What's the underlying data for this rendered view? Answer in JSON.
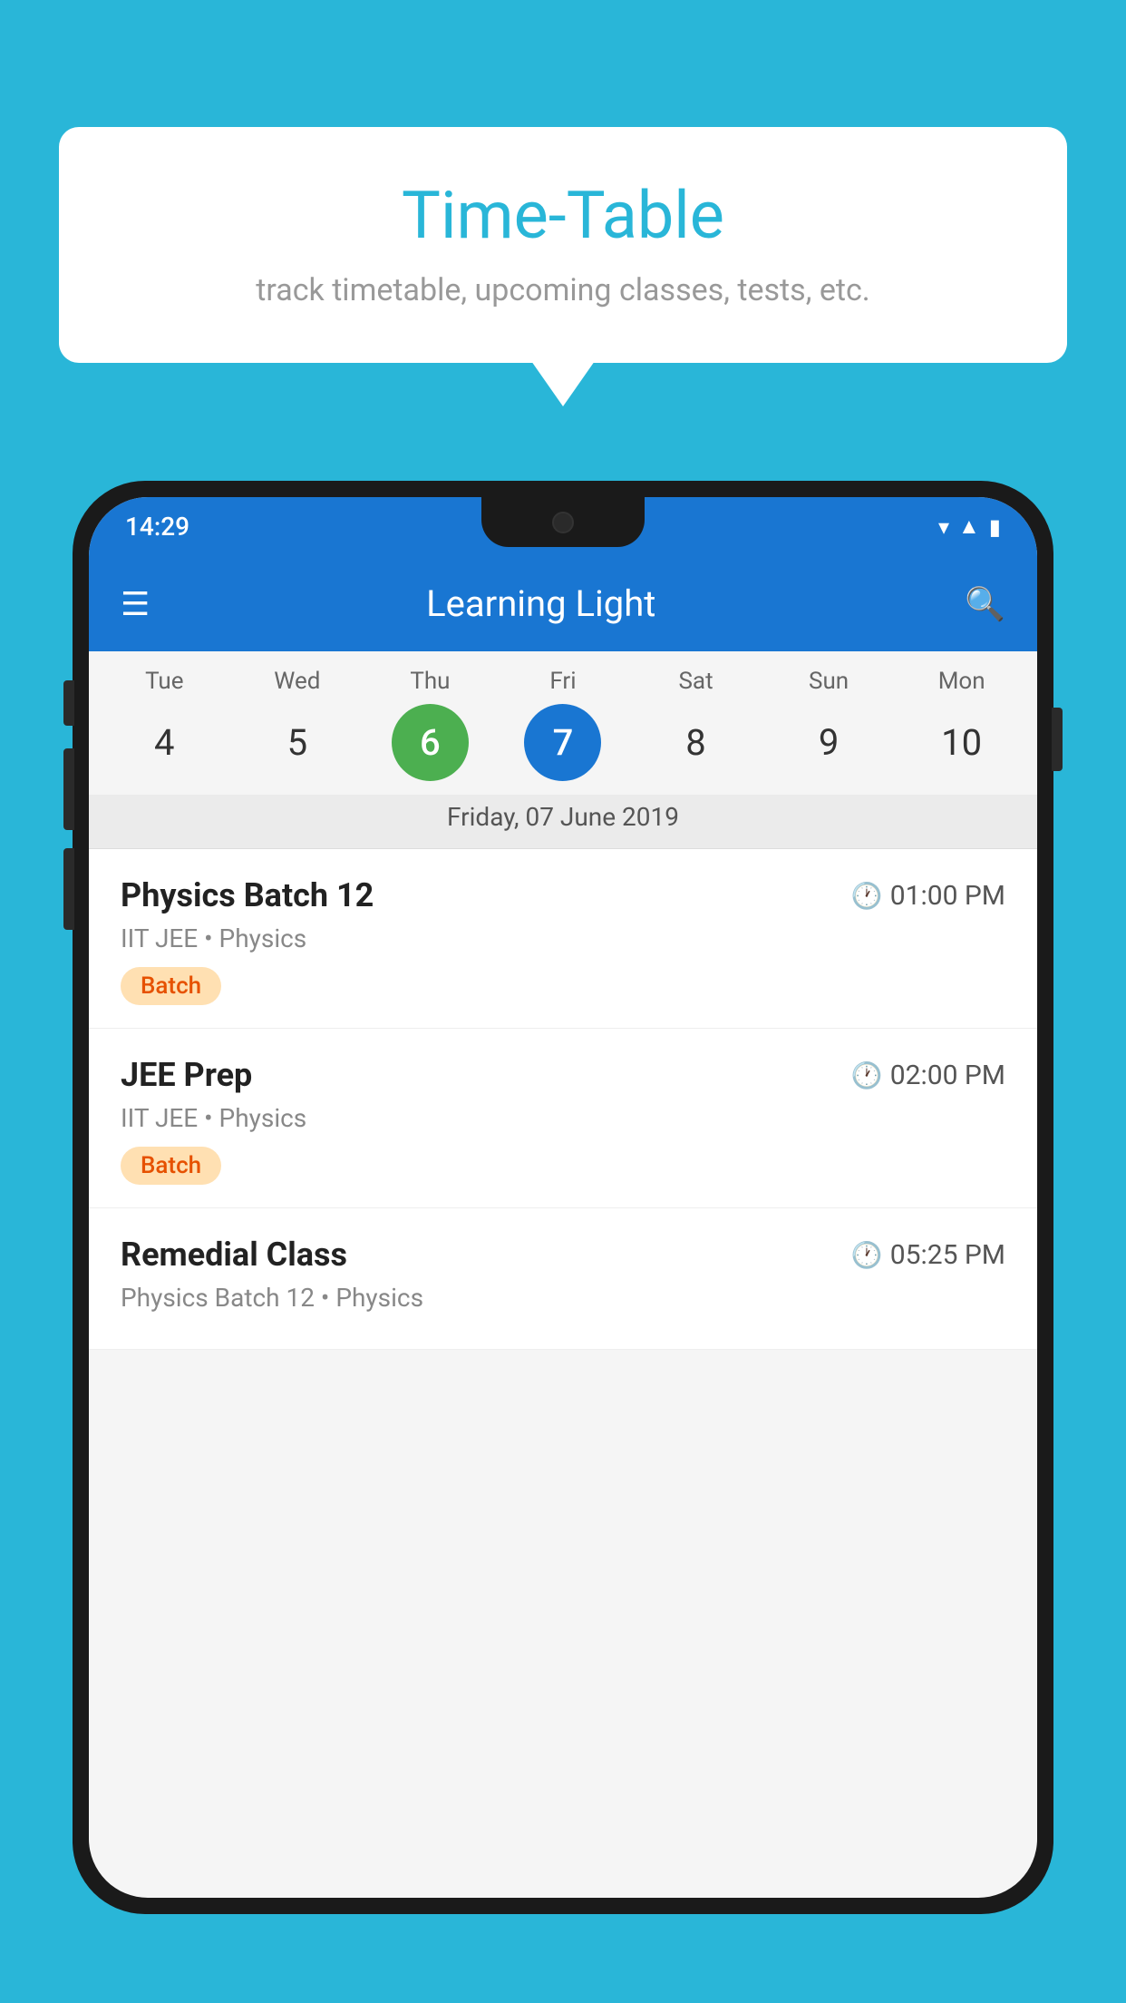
{
  "background": {
    "color": "#29B6D8"
  },
  "speech_bubble": {
    "title": "Time-Table",
    "subtitle": "track timetable, upcoming classes, tests, etc."
  },
  "phone": {
    "status_bar": {
      "time": "14:29"
    },
    "app_bar": {
      "title": "Learning Light"
    },
    "calendar": {
      "days": [
        {
          "name": "Tue",
          "number": "4",
          "state": "normal"
        },
        {
          "name": "Wed",
          "number": "5",
          "state": "normal"
        },
        {
          "name": "Thu",
          "number": "6",
          "state": "today"
        },
        {
          "name": "Fri",
          "number": "7",
          "state": "selected"
        },
        {
          "name": "Sat",
          "number": "8",
          "state": "normal"
        },
        {
          "name": "Sun",
          "number": "9",
          "state": "normal"
        },
        {
          "name": "Mon",
          "number": "10",
          "state": "normal"
        }
      ],
      "selected_date_label": "Friday, 07 June 2019"
    },
    "schedule": [
      {
        "title": "Physics Batch 12",
        "time": "01:00 PM",
        "sub": "IIT JEE • Physics",
        "badge": "Batch"
      },
      {
        "title": "JEE Prep",
        "time": "02:00 PM",
        "sub": "IIT JEE • Physics",
        "badge": "Batch"
      },
      {
        "title": "Remedial Class",
        "time": "05:25 PM",
        "sub": "Physics Batch 12 • Physics",
        "badge": null
      }
    ]
  }
}
